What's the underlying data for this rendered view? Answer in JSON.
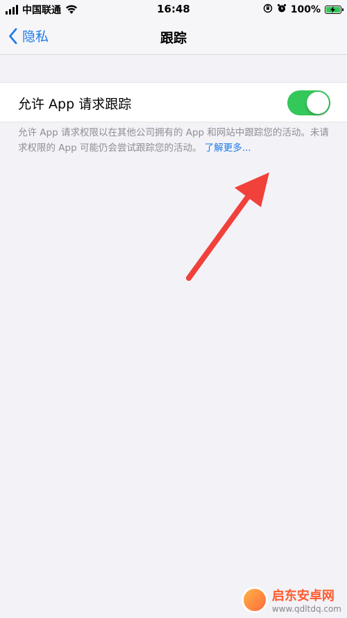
{
  "status_bar": {
    "carrier": "中国联通",
    "time": "16:48",
    "battery_percent": "100%",
    "icons": [
      "signal-icon",
      "wifi-icon",
      "orientation-lock-icon",
      "alarm-icon",
      "battery-charging-icon"
    ]
  },
  "nav": {
    "back_label": "隐私",
    "title": "跟踪"
  },
  "setting": {
    "label": "允许 App 请求跟踪",
    "toggle_state": "on"
  },
  "footer": {
    "description": "允许 App 请求权限以在其他公司拥有的 App 和网站中跟踪您的活动。未请求权限的 App 可能仍会尝试跟踪您的活动。",
    "learn_more": "了解更多..."
  },
  "annotation": {
    "type": "red-arrow",
    "color": "#f0413a"
  },
  "watermark": {
    "title": "启东安卓网",
    "url": "www.qdltdq.com"
  },
  "colors": {
    "accent": "#1f7ae8",
    "toggle_on": "#34c759",
    "background": "#f2f2f7"
  }
}
